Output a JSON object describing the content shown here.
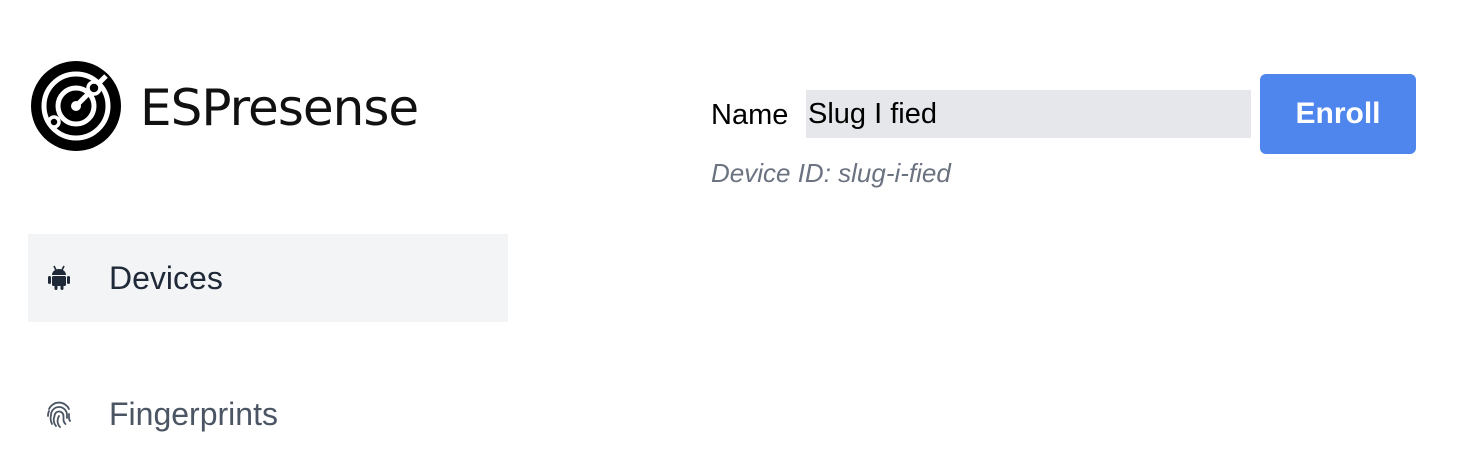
{
  "brand": {
    "name": "ESPresense",
    "logo_icon": "radar-icon"
  },
  "sidebar": {
    "items": [
      {
        "label": "Devices",
        "icon": "android-icon",
        "active": true
      },
      {
        "label": "Fingerprints",
        "icon": "fingerprint-icon",
        "active": false
      }
    ]
  },
  "form": {
    "name_label": "Name",
    "name_value": "Slug I fied",
    "enroll_label": "Enroll",
    "device_id_text": "Device ID: slug-i-fied"
  },
  "colors": {
    "accent": "#4e86ed",
    "active_nav_bg": "#f3f4f6",
    "input_bg": "#e5e7eb"
  }
}
